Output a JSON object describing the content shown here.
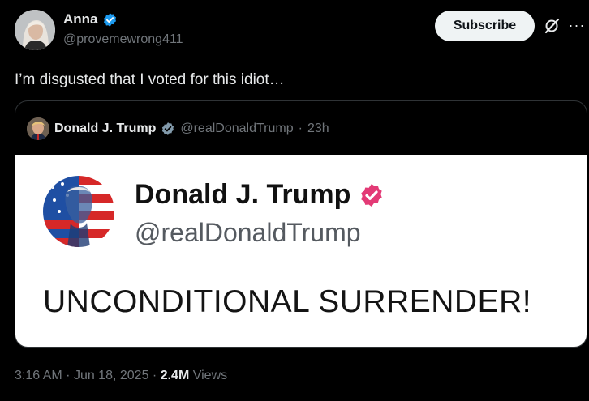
{
  "author": {
    "display_name": "Anna",
    "handle": "@provemewrong411",
    "verified_icon": "verified-badge-icon"
  },
  "actions": {
    "subscribe_label": "Subscribe",
    "grok_icon": "grok-icon",
    "more_icon": "more-icon",
    "more_glyph": "···"
  },
  "post": {
    "text": "I’m disgusted that I voted for this idiot…"
  },
  "quoted": {
    "display_name": "Donald J. Trump",
    "handle": "@realDonaldTrump",
    "separator": "·",
    "time": "23h",
    "image": {
      "display_name": "Donald J. Trump",
      "handle": "@realDonaldTrump",
      "text": "UNCONDITIONAL SURRENDER!"
    }
  },
  "meta": {
    "time": "3:16 AM",
    "sep1": "·",
    "date": "Jun 18, 2025",
    "sep2": "·",
    "views_count": "2.4M",
    "views_label": "Views"
  },
  "colors": {
    "background": "#000000",
    "text_primary": "#e7e9ea",
    "text_secondary": "#71767b",
    "verified_blue": "#1d9bf0",
    "verified_pink": "#e33a76",
    "border": "#2f3336"
  }
}
